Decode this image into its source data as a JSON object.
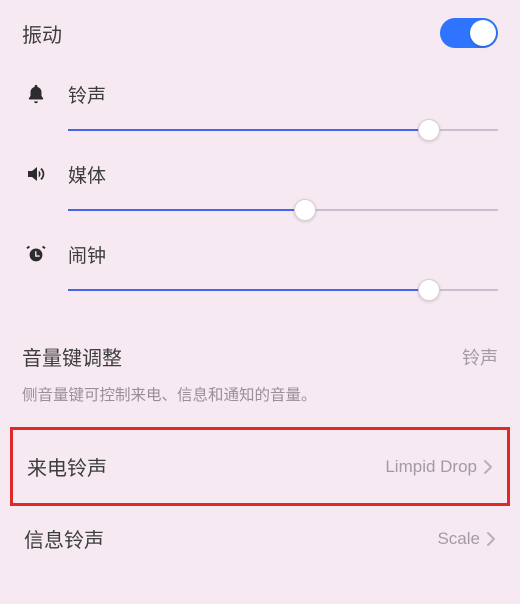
{
  "vibration": {
    "label": "振动",
    "enabled": true
  },
  "volumes": {
    "ring": {
      "label": "铃声",
      "percent": 84
    },
    "media": {
      "label": "媒体",
      "percent": 55
    },
    "alarm": {
      "label": "闹钟",
      "percent": 84
    }
  },
  "volumeKey": {
    "title": "音量键调整",
    "value": "铃声",
    "description": "侧音量键可控制来电、信息和通知的音量。"
  },
  "ringtone": {
    "incoming": {
      "label": "来电铃声",
      "value": "Limpid Drop"
    },
    "message": {
      "label": "信息铃声",
      "value": "Scale"
    }
  },
  "colors": {
    "accent": "#2e74ff",
    "slider_fill": "#4a62f0",
    "bg": "#f6e9f1",
    "highlight_border": "#e02a2a"
  }
}
